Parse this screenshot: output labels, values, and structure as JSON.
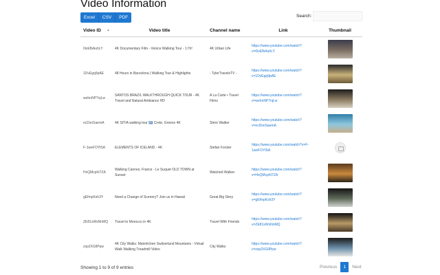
{
  "title": "Video Information",
  "export": [
    "Excel",
    "CSV",
    "PDF"
  ],
  "search": {
    "label": "Search:",
    "value": ""
  },
  "columns": [
    "Video ID",
    "Video title",
    "Channel name",
    "Link",
    "Thumbnail"
  ],
  "rows": [
    {
      "id": "0ivEfbAuhLY",
      "title": "4K Documentary Film - Venice Walking Tour - 1 Hr!",
      "channel": "4K Urban Life",
      "link": "https://www.youtube.com/watch?v=0ivEfbAuhLY",
      "thumb": "venice-thumbnail",
      "colors": [
        "#3b3b4a",
        "#7a6d62",
        "#b8ad9f"
      ]
    },
    {
      "id": "1DvEgq9pAE",
      "title": "48 Hours in Barcelona | Walking Tour & Highlights",
      "channel": "- TylerTravelsTV -",
      "link": "https://www.youtube.com/watch?v=1DvEgq9pAE",
      "thumb": "barcelona-thumbnail",
      "colors": [
        "#2a2a2a",
        "#c9b27a",
        "#6d5a3a"
      ]
    },
    {
      "id": "wehnNP7njLw",
      "title": "SANTOS BRAZIL WALKTHROUGH QUICK TOUR - 4K Travel and Natural Ambiance HD",
      "channel": "A La Carte • Travel Films",
      "link": "https://www.youtube.com/watch?v=wehnNP7njLw",
      "thumb": "santos-thumbnail",
      "colors": [
        "#1e1e1e",
        "#8a7a60",
        "#d8d0c0"
      ]
    },
    {
      "id": "ecDsnSaemA",
      "title": "4K SITIA walking tour 🇬🇷 Crete, Greece 4K",
      "channel": "Stere Walker",
      "link": "https://www.youtube.com/watch?v=ecDsnSaemA",
      "thumb": "sitia-thumbnail",
      "colors": [
        "#2f7fa8",
        "#8fc6de",
        "#c7b08a"
      ]
    },
    {
      "id": "F-1weFOYlSA",
      "title": "ELEMENTS OF ICELAND - 4K",
      "channel": "Stefan Forster",
      "link": "https://www.youtube.com/watch?v=F-1weFOYlSA",
      "thumb": "",
      "colors": []
    },
    {
      "id": "HxQMcphI7ZA",
      "title": "Walking Cannes, France - Le Suquet OLD TOWN at Sunset",
      "channel": "Watched Walker",
      "link": "https://www.youtube.com/watch?v=HxQMcphI7ZA",
      "thumb": "cannes-thumbnail",
      "colors": [
        "#5a3a1e",
        "#c98a3e",
        "#2e2418"
      ]
    },
    {
      "id": "gEfmpKsh3Y",
      "title": "Need a Change of Scenery? Join us in Hawaii",
      "channel": "Great Big Story",
      "link": "https://www.youtube.com/watch?v=gEfmpKsh3Y",
      "thumb": "hawaii-thumbnail",
      "colors": [
        "#151515",
        "#5f6a5a",
        "#d0d4cf"
      ]
    },
    {
      "id": "ZE81sWsNnMQ",
      "title": "Travel to Morocco in 4K",
      "channel": "Travel With Friends",
      "link": "https://www.youtube.com/watch?v=ZE81sWsNnMQ",
      "thumb": "morocco-thumbnail",
      "colors": [
        "#111111",
        "#b89968",
        "#4b3a28"
      ]
    },
    {
      "id": "zsp2XGIlPpw",
      "title": "4K City Walks: Mannlichen Switzerland Mountains - Virtual Walk Walking Treadmill Video",
      "channel": "City Walks",
      "link": "https://www.youtube.com/watch?v=zsp2XGIlPpw",
      "thumb": "mannlichen-thumbnail",
      "colors": [
        "#1a1a1a",
        "#6b8fa8",
        "#e6e6e6"
      ]
    }
  ],
  "info": "Showing 1 to 9 of 9 entries",
  "pager": {
    "prev": "Previous",
    "current": "1",
    "next": "Next"
  }
}
